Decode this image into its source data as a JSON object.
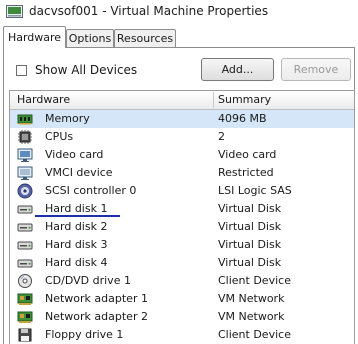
{
  "window": {
    "title": "dacvsof001 - Virtual Machine Properties"
  },
  "tabs": [
    {
      "label": "Hardware",
      "active": true
    },
    {
      "label": "Options",
      "active": false
    },
    {
      "label": "Resources",
      "active": false
    }
  ],
  "show_all_devices": {
    "label": "Show All Devices",
    "checked": false
  },
  "buttons": {
    "add": "Add...",
    "remove": "Remove"
  },
  "grid": {
    "columns": [
      "Hardware",
      "Summary"
    ],
    "rows": [
      {
        "name": "Memory",
        "summary": "4096 MB",
        "icon": "memory-icon",
        "selected": true
      },
      {
        "name": "CPUs",
        "summary": "2",
        "icon": "cpu-icon"
      },
      {
        "name": "Video card",
        "summary": "Video card",
        "icon": "video-card-icon"
      },
      {
        "name": "VMCI device",
        "summary": "Restricted",
        "icon": "vmci-device-icon"
      },
      {
        "name": "SCSI controller 0",
        "summary": "LSI Logic SAS",
        "icon": "scsi-controller-icon"
      },
      {
        "name": "Hard disk 1",
        "summary": "Virtual Disk",
        "icon": "hard-disk-icon"
      },
      {
        "name": "Hard disk 2",
        "summary": "Virtual Disk",
        "icon": "hard-disk-icon"
      },
      {
        "name": "Hard disk 3",
        "summary": "Virtual Disk",
        "icon": "hard-disk-icon"
      },
      {
        "name": "Hard disk 4",
        "summary": "Virtual Disk",
        "icon": "hard-disk-icon"
      },
      {
        "name": "CD/DVD drive 1",
        "summary": "Client Device",
        "icon": "cd-dvd-drive-icon"
      },
      {
        "name": "Network adapter 1",
        "summary": "VM Network",
        "icon": "network-adapter-icon"
      },
      {
        "name": "Network adapter 2",
        "summary": "VM Network",
        "icon": "network-adapter-icon"
      },
      {
        "name": "Floppy drive 1",
        "summary": "Client Device",
        "icon": "floppy-drive-icon"
      }
    ]
  },
  "colors": {
    "selection": "#d5e6f8",
    "annotation_underline": "#1f2fa8"
  }
}
